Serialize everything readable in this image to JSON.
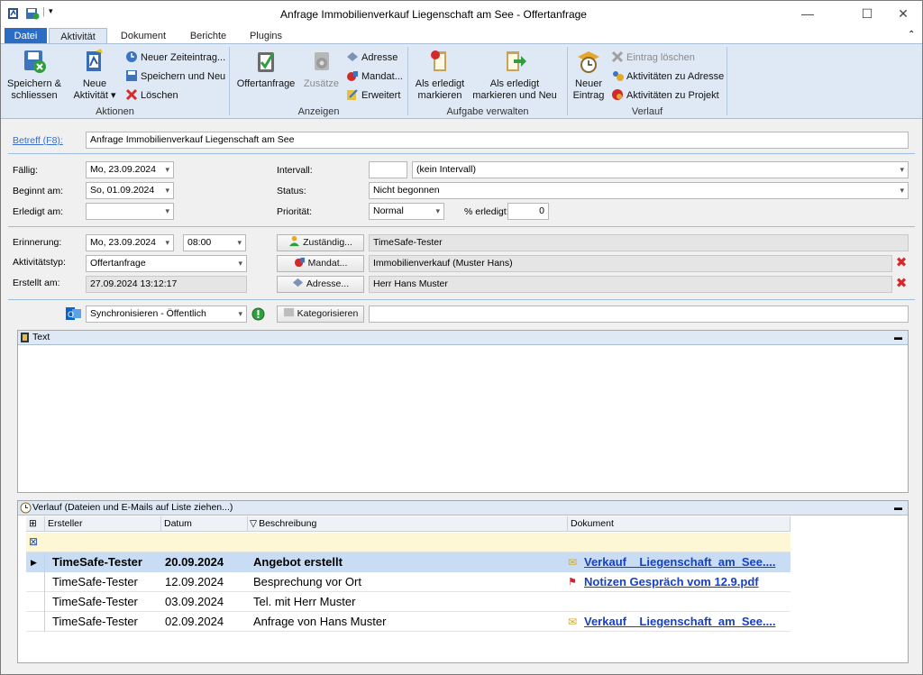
{
  "window": {
    "title": "Anfrage Immobilienverkauf Liegenschaft am See - Offertanfrage",
    "controls": {
      "minimize": "—",
      "maximize": "☐",
      "close": "✕"
    }
  },
  "tabs": [
    "Datei",
    "Aktivität",
    "Dokument",
    "Berichte",
    "Plugins"
  ],
  "ribbon": {
    "aktionen": {
      "label": "Aktionen",
      "save_close": "Speichern & schliessen",
      "new_activity": "Neue Aktivität",
      "new_time": "Neuer Zeiteintrag...",
      "save_new": "Speichern und Neu",
      "delete": "Löschen"
    },
    "anzeigen": {
      "label": "Anzeigen",
      "offertanfrage": "Offertanfrage",
      "zusaetze": "Zusätze",
      "adresse": "Adresse",
      "mandat": "Mandat...",
      "erweitert": "Erweitert"
    },
    "aufgabe": {
      "label": "Aufgabe verwalten",
      "done": "Als erledigt markieren",
      "done_new": "Als erledigt markieren und Neu"
    },
    "verlauf": {
      "label": "Verlauf",
      "new_entry": "Neuer Eintrag",
      "delete_entry": "Eintrag löschen",
      "to_address": "Aktivitäten zu Adresse",
      "to_project": "Aktivitäten zu Projekt"
    }
  },
  "form": {
    "betreff_label": "Betreff (F8):",
    "betreff": "Anfrage Immobilienverkauf Liegenschaft am See",
    "faellig_label": "Fällig:",
    "faellig": "Mo, 23.09.2024",
    "beginnt_label": "Beginnt am:",
    "beginnt": "So, 01.09.2024",
    "erledigt_label": "Erledigt am:",
    "erledigt": "",
    "intervall_label": "Intervall:",
    "intervall_num": "",
    "intervall": "(kein Intervall)",
    "status_label": "Status:",
    "status": "Nicht begonnen",
    "prioritaet_label": "Priorität:",
    "prioritaet": "Normal",
    "pct_label": "% erledigt:",
    "pct": "0",
    "erinnerung_label": "Erinnerung:",
    "erinnerung_date": "Mo, 23.09.2024",
    "erinnerung_time": "08:00",
    "aktivitaetstyp_label": "Aktivitätstyp:",
    "aktivitaetstyp": "Offertanfrage",
    "erstellt_label": "Erstellt am:",
    "erstellt": "27.09.2024 13:12:17",
    "zustaendig_btn": "Zuständig...",
    "zustaendig": "TimeSafe-Tester",
    "mandat_btn": "Mandat...",
    "mandat": "Immobilienverkauf  (Muster Hans)",
    "adresse_btn": "Adresse...",
    "adresse": "Herr Hans Muster",
    "sync": "Synchronisieren - Öffentlich",
    "kategorisieren_btn": "Kategorisieren",
    "kategorien": ""
  },
  "text_panel": {
    "title": "Text",
    "content": ""
  },
  "history_panel": {
    "title": "Verlauf (Dateien und E-Mails auf Liste ziehen...)",
    "columns": [
      "Ersteller",
      "Datum",
      "Beschreibung",
      "Dokument"
    ],
    "rows": [
      {
        "ersteller": "TimeSafe-Tester",
        "datum": "20.09.2024",
        "beschreibung": "Angebot erstellt",
        "dokument": "Verkauf _ Liegenschaft_am_See....",
        "doc_type": "email"
      },
      {
        "ersteller": "TimeSafe-Tester",
        "datum": "12.09.2024",
        "beschreibung": "Besprechung vor Ort",
        "dokument": "Notizen Gespräch vom 12.9.pdf",
        "doc_type": "pdf"
      },
      {
        "ersteller": "TimeSafe-Tester",
        "datum": "03.09.2024",
        "beschreibung": "Tel. mit Herr Muster",
        "dokument": "",
        "doc_type": ""
      },
      {
        "ersteller": "TimeSafe-Tester",
        "datum": "02.09.2024",
        "beschreibung": "Anfrage von Hans Muster",
        "dokument": "Verkauf _ Liegenschaft_am_See....",
        "doc_type": "email"
      }
    ]
  }
}
